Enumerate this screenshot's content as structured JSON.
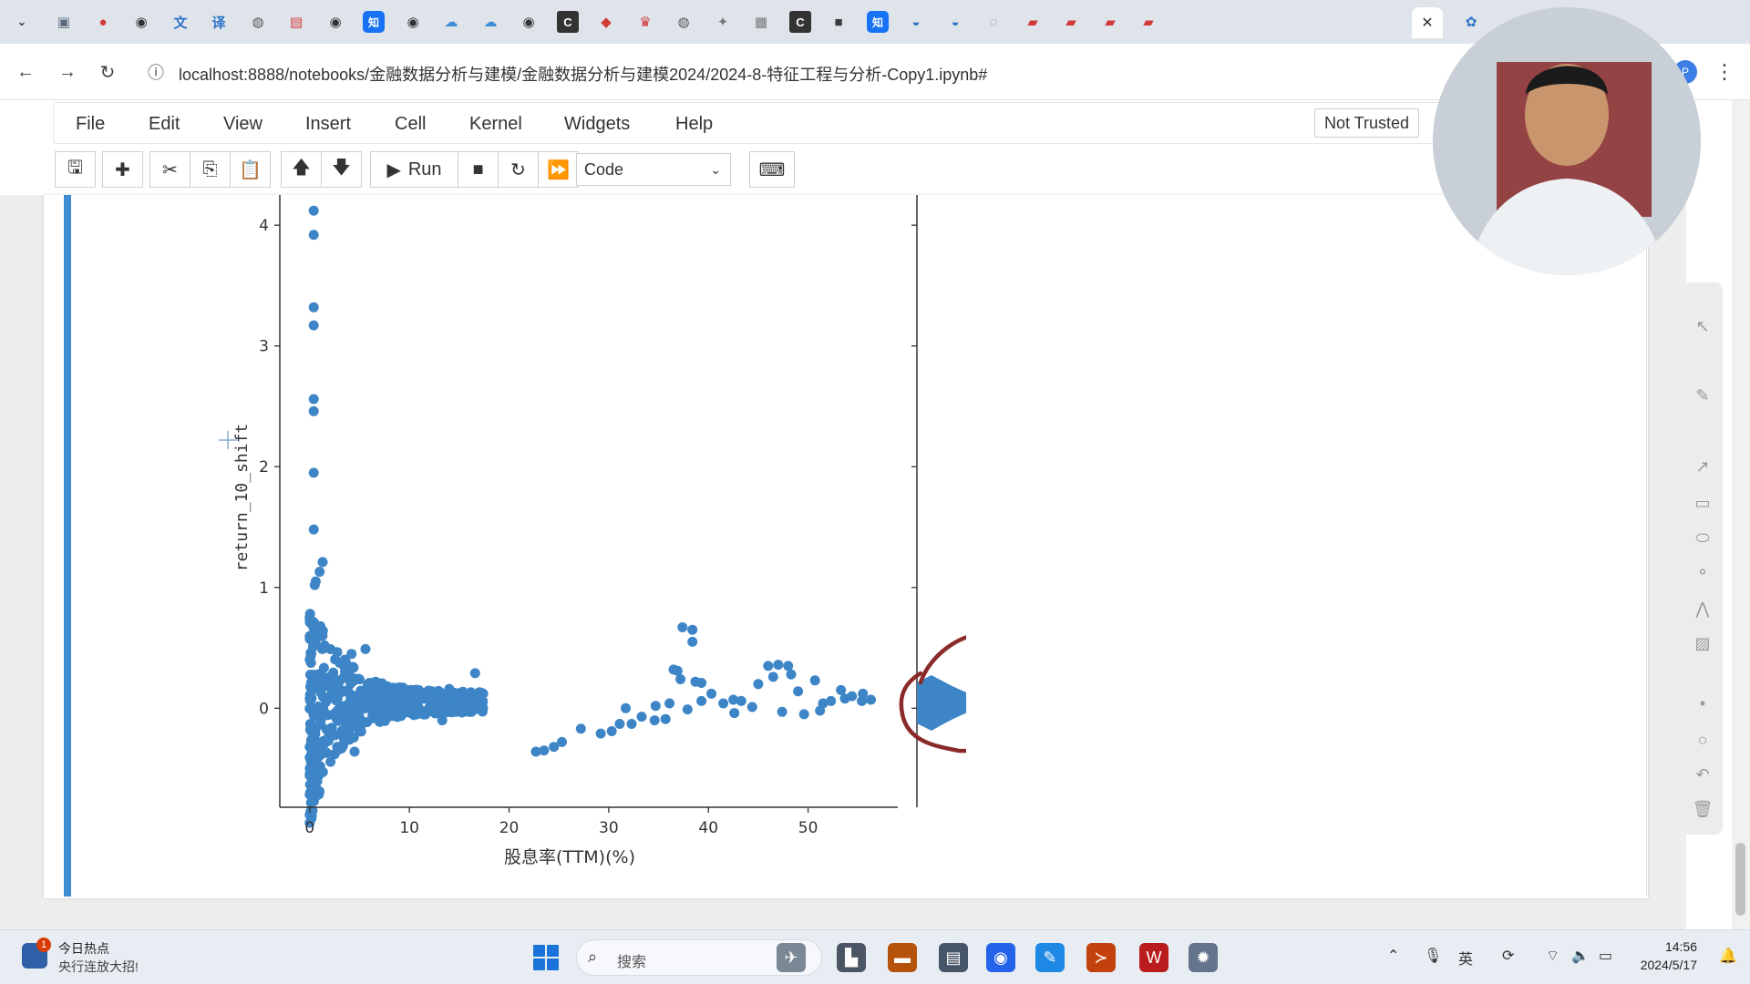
{
  "browser": {
    "url": "localhost:8888/notebooks/金融数据分析与建模/金融数据分析与建模2024/2024-8-特征工程与分析-Copy1.ipynb#",
    "tab_icons": [
      {
        "name": "video-icon",
        "glyph": "▣",
        "cls": "i-video"
      },
      {
        "name": "record-icon",
        "glyph": "●",
        "cls": "i-red"
      },
      {
        "name": "github-icon",
        "glyph": "◉",
        "cls": "i-gh"
      },
      {
        "name": "translate-icon",
        "glyph": "文",
        "cls": "i-blue"
      },
      {
        "name": "translate-alt-icon",
        "glyph": "译",
        "cls": "i-blue"
      },
      {
        "name": "globe-icon",
        "glyph": "◍",
        "cls": "i-globe"
      },
      {
        "name": "tv-icon",
        "glyph": "▤",
        "cls": "i-red"
      },
      {
        "name": "github-icon",
        "glyph": "◉",
        "cls": "i-gh"
      },
      {
        "name": "zhihu-icon",
        "glyph": "知",
        "cls": "i-zhi"
      },
      {
        "name": "github-icon",
        "glyph": "◉",
        "cls": "i-gh"
      },
      {
        "name": "cloud-icon",
        "glyph": "☁",
        "cls": "i-cloud"
      },
      {
        "name": "cloud-icon",
        "glyph": "☁",
        "cls": "i-cloud"
      },
      {
        "name": "github-icon",
        "glyph": "◉",
        "cls": "i-gh"
      },
      {
        "name": "c-app-icon",
        "glyph": "C",
        "cls": "i-c"
      },
      {
        "name": "chat-icon",
        "glyph": "◆",
        "cls": "i-red"
      },
      {
        "name": "crown-icon",
        "glyph": "♛",
        "cls": "i-red"
      },
      {
        "name": "globe-icon",
        "glyph": "◍",
        "cls": "i-globe"
      },
      {
        "name": "pin-icon",
        "glyph": "✦",
        "cls": "i-gray"
      },
      {
        "name": "print-icon",
        "glyph": "▦",
        "cls": "i-gray"
      },
      {
        "name": "c-app-icon",
        "glyph": "C",
        "cls": "i-c"
      },
      {
        "name": "camera-icon",
        "glyph": "■",
        "cls": "i-dark"
      },
      {
        "name": "zhihu-icon",
        "glyph": "知",
        "cls": "i-zhi"
      },
      {
        "name": "bowl-icon",
        "glyph": "◒",
        "cls": "i-blue"
      },
      {
        "name": "bowl-icon",
        "glyph": "◒",
        "cls": "i-blue"
      },
      {
        "name": "loading-icon",
        "glyph": "◌",
        "cls": "i-gray"
      },
      {
        "name": "book-icon",
        "glyph": "▰",
        "cls": "i-red"
      },
      {
        "name": "book-icon",
        "glyph": "▰",
        "cls": "i-red"
      },
      {
        "name": "book-icon",
        "glyph": "▰",
        "cls": "i-red"
      },
      {
        "name": "book-icon",
        "glyph": "▰",
        "cls": "i-red"
      }
    ],
    "tab_after_active": {
      "name": "paw-icon",
      "glyph": "✿",
      "cls": "i-blue"
    },
    "active_tab_close": "✕",
    "profile_initial": "P"
  },
  "jupyter": {
    "menus": [
      "File",
      "Edit",
      "View",
      "Insert",
      "Cell",
      "Kernel",
      "Widgets",
      "Help"
    ],
    "trust": "Not Trusted",
    "toolbar": {
      "run_label": "Run",
      "cell_type": "Code",
      "glyphs": {
        "save": "🖫",
        "add": "✚",
        "cut": "✂",
        "copy": "⎘",
        "paste": "📋",
        "up": "🡅",
        "down": "🡇",
        "run": "▶",
        "stop": "■",
        "restart": "↻",
        "fastforward": "⏩",
        "keyboard": "⌨"
      }
    }
  },
  "chart_data": {
    "type": "scatter",
    "xlabel": "股息率(TTM)(%)",
    "ylabel": "return_10_shift",
    "xlim": [
      -3,
      59
    ],
    "ylim": [
      -0.82,
      4.25
    ],
    "xticks": [
      0,
      10,
      20,
      30,
      40,
      50
    ],
    "yticks": [
      0,
      1,
      2,
      3,
      4
    ],
    "point_color": "#3d85c6",
    "annotation_color": "#8b2a2a",
    "series": [
      {
        "values": [
          [
            0.4,
            4.12
          ],
          [
            0.4,
            3.92
          ],
          [
            0.4,
            3.32
          ],
          [
            0.4,
            3.17
          ],
          [
            0.4,
            2.56
          ],
          [
            0.4,
            2.46
          ],
          [
            0.4,
            1.95
          ],
          [
            0.4,
            1.48
          ],
          [
            1.3,
            1.21
          ],
          [
            1.0,
            1.13
          ],
          [
            0.6,
            1.05
          ],
          [
            0.5,
            1.02
          ],
          [
            5.6,
            0.49
          ],
          [
            4.2,
            0.45
          ],
          [
            8.5,
            0.16
          ],
          [
            12.0,
            0.12
          ],
          [
            14.0,
            0.16
          ],
          [
            16.6,
            0.29
          ],
          [
            17.4,
            0.12
          ],
          [
            16.8,
            0.05
          ],
          [
            15.5,
            0.09
          ],
          [
            13.3,
            -0.1
          ],
          [
            10.8,
            -0.05
          ],
          [
            22.7,
            -0.36
          ],
          [
            23.5,
            -0.35
          ],
          [
            24.5,
            -0.32
          ],
          [
            25.3,
            -0.28
          ],
          [
            27.2,
            -0.17
          ],
          [
            29.2,
            -0.21
          ],
          [
            30.3,
            -0.19
          ],
          [
            31.1,
            -0.13
          ],
          [
            32.3,
            -0.13
          ],
          [
            31.7,
            0.0
          ],
          [
            33.3,
            -0.07
          ],
          [
            34.6,
            -0.1
          ],
          [
            35.7,
            -0.09
          ],
          [
            36.1,
            0.04
          ],
          [
            37.4,
            0.67
          ],
          [
            38.4,
            0.65
          ],
          [
            38.4,
            0.55
          ],
          [
            36.9,
            0.31
          ],
          [
            36.5,
            0.32
          ],
          [
            37.2,
            0.24
          ],
          [
            38.7,
            0.22
          ],
          [
            39.3,
            0.21
          ],
          [
            40.3,
            0.12
          ],
          [
            41.5,
            0.04
          ],
          [
            42.5,
            0.07
          ],
          [
            43.3,
            0.06
          ],
          [
            45.0,
            0.2
          ],
          [
            46.0,
            0.35
          ],
          [
            47.0,
            0.36
          ],
          [
            46.5,
            0.26
          ],
          [
            48.0,
            0.35
          ],
          [
            48.3,
            0.28
          ],
          [
            49.0,
            0.14
          ],
          [
            50.7,
            0.23
          ],
          [
            51.5,
            0.04
          ],
          [
            52.3,
            0.06
          ],
          [
            53.3,
            0.15
          ],
          [
            53.7,
            0.08
          ],
          [
            54.4,
            0.1
          ],
          [
            55.4,
            0.06
          ],
          [
            56.3,
            0.07
          ],
          [
            55.5,
            0.12
          ],
          [
            34.7,
            0.02
          ],
          [
            37.9,
            -0.01
          ],
          [
            39.3,
            0.06
          ],
          [
            42.6,
            -0.04
          ],
          [
            44.4,
            0.01
          ],
          [
            47.4,
            -0.03
          ],
          [
            49.6,
            -0.05
          ],
          [
            51.2,
            -0.02
          ],
          [
            0.2,
            -0.56
          ],
          [
            0.3,
            -0.49
          ],
          [
            0.5,
            -0.42
          ],
          [
            1.0,
            -0.36
          ],
          [
            2.5,
            -0.38
          ],
          [
            4.5,
            -0.36
          ]
        ]
      }
    ],
    "dense_cloud": "a dense cluster of overlapping points near x 0–5, y −0.5–0.8, tapering toward x≈17"
  },
  "taskbar": {
    "news_badge": "1",
    "news_title": "今日热点",
    "news_sub": "央行连放大招!",
    "search_placeholder": "搜索",
    "time": "14:56",
    "date": "2024/5/17",
    "tray_ime": "英",
    "apps": [
      {
        "name": "bird-app-icon",
        "glyph": "✈",
        "bg": "#7a8794"
      },
      {
        "name": "file-explorer-icon",
        "glyph": "▙",
        "bg": "#4b5563"
      },
      {
        "name": "folder-icon",
        "glyph": "▬",
        "bg": "#b45309"
      },
      {
        "name": "notebook-app-icon",
        "glyph": "▤",
        "bg": "#475569"
      },
      {
        "name": "chrome-icon",
        "glyph": "◉",
        "bg": "#2563eb"
      },
      {
        "name": "pen-app-icon",
        "glyph": "✎",
        "bg": "#1e88e5"
      },
      {
        "name": "terminal-icon",
        "glyph": "≻",
        "bg": "#c2410c"
      },
      {
        "name": "wps-icon",
        "glyph": "W",
        "bg": "#b91c1c"
      },
      {
        "name": "settings-gear-icon",
        "glyph": "✹",
        "bg": "#64748b"
      }
    ]
  }
}
